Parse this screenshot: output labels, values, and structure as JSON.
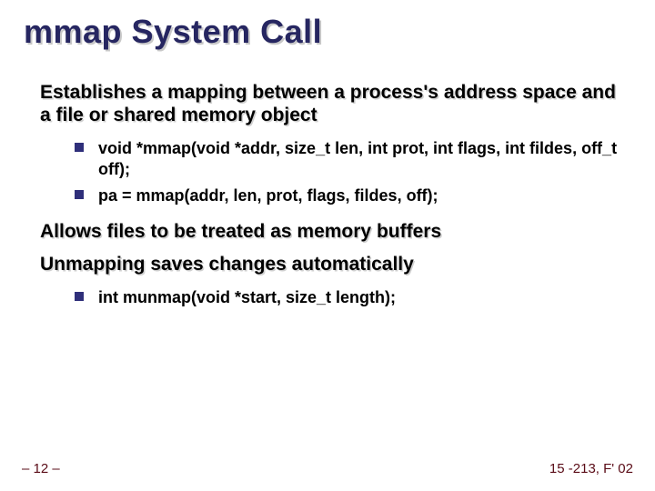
{
  "title": "mmap System Call",
  "points": [
    {
      "text": "Establishes a mapping between a process's address space and a file or shared memory object",
      "subs": [
        "void *mmap(void *addr, size_t len, int prot, int flags, int fildes, off_t off);",
        "pa = mmap(addr, len, prot, flags, fildes, off);"
      ]
    },
    {
      "text": "Allows files to be treated as memory buffers",
      "subs": []
    },
    {
      "text": "Unmapping saves changes automatically",
      "subs": [
        "int munmap(void *start, size_t length);"
      ]
    }
  ],
  "footer": {
    "left": "– 12 –",
    "right": "15 -213, F' 02"
  }
}
